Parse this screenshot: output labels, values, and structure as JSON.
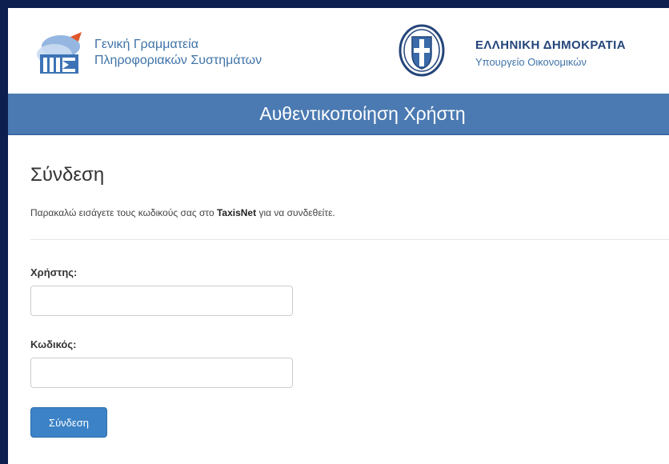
{
  "header": {
    "gsis_logo": "gsis-logo-icon",
    "gsis_name_line1": "Γενική Γραμματεία",
    "gsis_name_line2": "Πληροφοριακών Συστημάτων",
    "emblem": "hellenic-republic-emblem-icon",
    "gov_title": "ΕΛΛΗΝΙΚΗ ΔΗΜΟΚΡΑΤΙΑ",
    "gov_ministry": "Υπουργείο Οικονομικών"
  },
  "banner": {
    "title": "Αυθεντικοποίηση Χρήστη"
  },
  "login": {
    "heading": "Σύνδεση",
    "instruction_before": "Παρακαλώ εισάγετε τους κωδικούς σας στο ",
    "instruction_brand": "TaxisNet",
    "instruction_after": " για να συνδεθείτε.",
    "username_label": "Χρήστης:",
    "username_value": "",
    "password_label": "Κωδικός:",
    "password_value": "",
    "submit_label": "Σύνδεση"
  },
  "colors": {
    "page_border": "#0c1f4e",
    "banner_bg": "#4b7ab2",
    "button_bg": "#3c82c6",
    "gsis_text": "#3f73a8",
    "gov_title": "#24457a"
  }
}
